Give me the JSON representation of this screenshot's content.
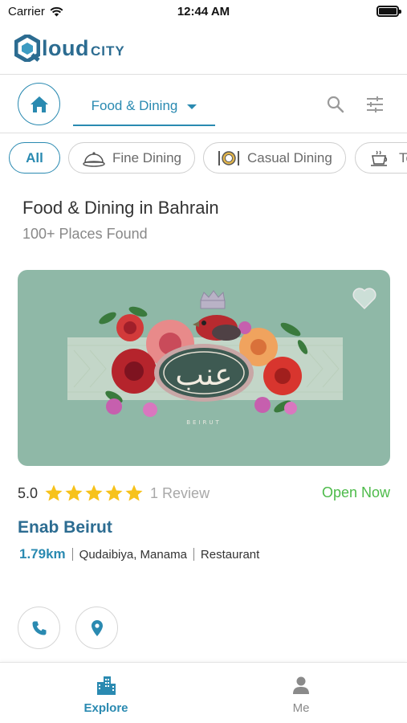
{
  "status_bar": {
    "carrier": "Carrier",
    "time": "12:44 AM"
  },
  "app": {
    "logo_main": "loud",
    "logo_sub": "CITY",
    "brand_color": "#2c6c91",
    "accent_color": "#2a8ab1"
  },
  "nav": {
    "category": "Food & Dining"
  },
  "chips": [
    {
      "label": "All",
      "icon": ""
    },
    {
      "label": "Fine Dining",
      "icon": "cloche-icon"
    },
    {
      "label": "Casual Dining",
      "icon": "plate-cutlery-icon"
    },
    {
      "label": "Te",
      "icon": "tea-cup-icon"
    }
  ],
  "results": {
    "title": "Food & Dining in Bahrain",
    "count": "100+ Places Found"
  },
  "card": {
    "rating": "5.0",
    "stars": 5,
    "reviews": "1 Review",
    "status": "Open Now",
    "status_color": "#4dbb4a",
    "name": "Enab Beirut",
    "distance": "1.79km",
    "location": "Qudaibiya, Manama",
    "type": "Restaurant",
    "logo_text": "عنب",
    "logo_sub": "BEIRUT"
  },
  "tabs": [
    {
      "label": "Explore",
      "icon": "city-buildings-icon",
      "active": true
    },
    {
      "label": "Me",
      "icon": "person-icon",
      "active": false
    }
  ]
}
